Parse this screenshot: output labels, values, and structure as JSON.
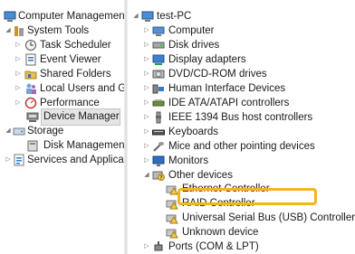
{
  "left_tree": {
    "root": "Computer Management",
    "system_tools": "System Tools",
    "task_scheduler": "Task Scheduler",
    "event_viewer": "Event Viewer",
    "shared_folders": "Shared Folders",
    "local_users": "Local Users and Gr",
    "performance": "Performance",
    "device_manager": "Device Manager",
    "storage": "Storage",
    "disk_management": "Disk Management",
    "services": "Services and Applicat"
  },
  "device_tree": {
    "root": "test-PC",
    "computer": "Computer",
    "disk_drives": "Disk drives",
    "display_adapters": "Display adapters",
    "dvd": "DVD/CD-ROM drives",
    "hid": "Human Interface Devices",
    "ide": "IDE ATA/ATAPI controllers",
    "ieee": "IEEE 1394 Bus host controllers",
    "keyboards": "Keyboards",
    "mice": "Mice and other pointing devices",
    "monitors": "Monitors",
    "other_devices": "Other devices",
    "ethernet": "Ethernet Controller",
    "raid": "RAID Controller",
    "usb": "Universal Serial Bus (USB) Controller",
    "unknown": "Unknown device",
    "ports": "Ports (COM & LPT)"
  },
  "icons": {
    "computer-management": "computer-management-icon",
    "tools": "tools-icon",
    "clock": "clock-icon",
    "event": "event-viewer-icon",
    "folder": "shared-folder-icon",
    "users": "users-icon",
    "performance": "performance-icon",
    "device-manager": "device-manager-icon",
    "storage": "storage-icon",
    "disk": "disk-icon",
    "services": "services-icon",
    "warning-device": "unknown-device-warning-icon"
  },
  "colors": {
    "highlight_border": "#f2b51a",
    "selection_bg": "#e5e5e5"
  }
}
